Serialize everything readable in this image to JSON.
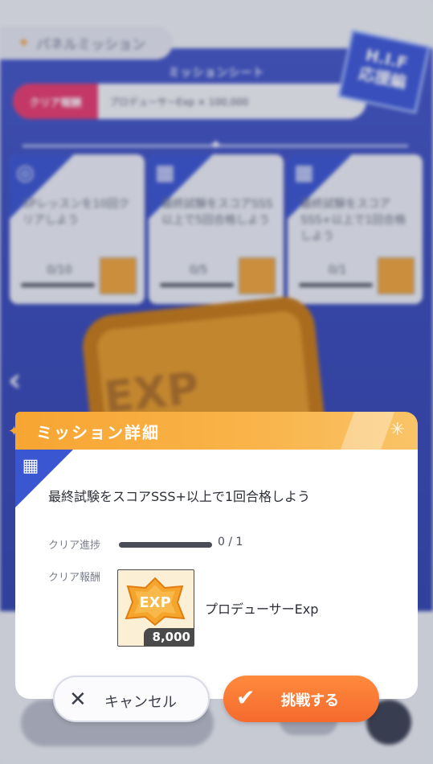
{
  "background": {
    "panel_tab_label": "パネルミッション",
    "sheet_title": "ミッションシート",
    "reward_tag": "クリア報酬",
    "reward_text": "プロデューサーExp × 100,000",
    "hif_badge_line1": "H.I.F",
    "hif_badge_line2": "応援編",
    "cards": [
      {
        "title": "SPレッスンを10回クリアしよう",
        "progress": "0/10"
      },
      {
        "title": "最終試験をスコアSSS以上で5回合格しよう",
        "progress": "0/5"
      },
      {
        "title": "最終試験をスコアSSS+以上で1回合格しよう",
        "progress": "0/1"
      }
    ],
    "big_exp_text": "EXP"
  },
  "modal": {
    "title": "ミッション詳細",
    "mission_text": "最終試験をスコアSSS+以上で1回合格しよう",
    "progress_label": "クリア進捗",
    "progress_value": "0 / 1",
    "progress_fraction": 0,
    "reward_label": "クリア報酬",
    "reward_icon_text": "EXP",
    "reward_quantity": "8,000",
    "reward_name": "プロデューサーExp"
  },
  "buttons": {
    "cancel_label": "キャンセル",
    "confirm_label": "挑戦する"
  },
  "colors": {
    "accent_orange": "#f7a532",
    "confirm_orange": "#f56a2e",
    "brand_blue": "#3a56d0"
  }
}
